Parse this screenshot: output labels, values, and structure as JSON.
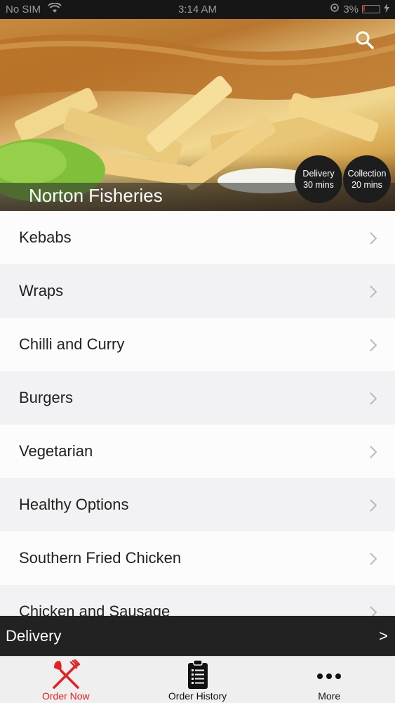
{
  "status_bar": {
    "carrier": "No SIM",
    "time": "3:14 AM",
    "battery": "3%"
  },
  "header": {
    "restaurant_name": "Norton Fisheries",
    "search_icon": "search-icon",
    "delivery_badge": {
      "label": "Delivery",
      "time": "30 mins"
    },
    "collection_badge": {
      "label": "Collection",
      "time": "20 mins"
    }
  },
  "menu": {
    "items": [
      {
        "label": "Kebabs"
      },
      {
        "label": "Wraps"
      },
      {
        "label": "Chilli and Curry"
      },
      {
        "label": "Burgers"
      },
      {
        "label": "Vegetarian"
      },
      {
        "label": "Healthy Options"
      },
      {
        "label": "Southern Fried Chicken"
      },
      {
        "label": "Chicken and Sausage"
      }
    ]
  },
  "delivery_bar": {
    "label": "Delivery",
    "arrow": ">"
  },
  "tab_bar": {
    "tabs": [
      {
        "label": "Order Now",
        "icon": "fork-knife-icon",
        "active": true
      },
      {
        "label": "Order History",
        "icon": "clipboard-list-icon",
        "active": false
      },
      {
        "label": "More",
        "icon": "more-dots-icon",
        "active": false
      }
    ]
  },
  "colors": {
    "accent": "#e32121",
    "dark_bar": "#222222",
    "status_bar": "#161616"
  }
}
